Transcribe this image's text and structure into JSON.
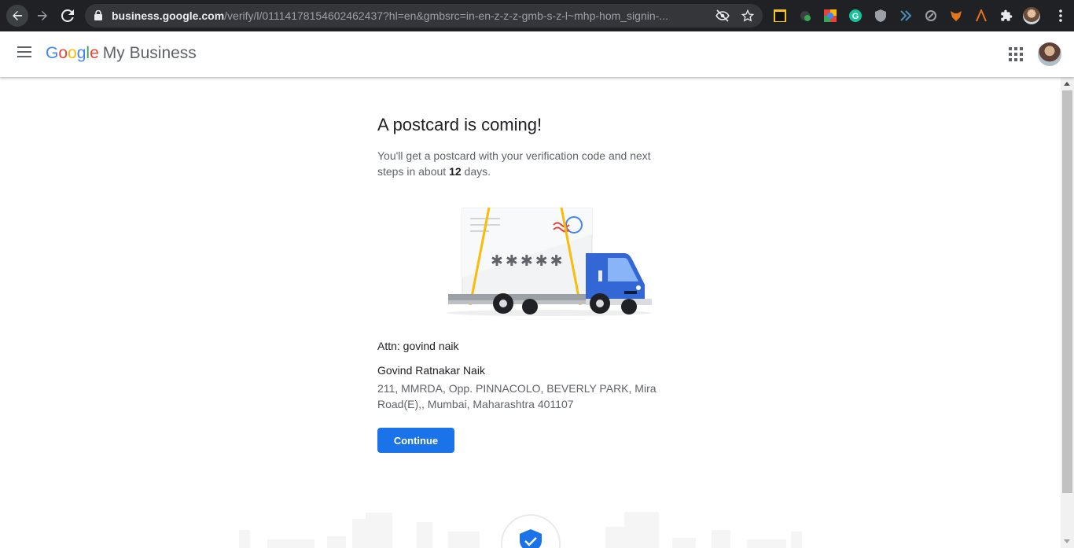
{
  "browser": {
    "url_host": "business.google.com",
    "url_path": "/verify/l/01114178154602462437?hl=en&gmbsrc=in-en-z-z-z-gmb-s-z-l~mhp-hom_signin-...",
    "icons": [
      "back-icon",
      "forward-icon",
      "reload-icon",
      "lock-icon",
      "eye-off-icon",
      "star-icon",
      "extensions-icon"
    ]
  },
  "header": {
    "logo_letters": [
      "G",
      "o",
      "o",
      "g",
      "l",
      "e"
    ],
    "product": "My Business"
  },
  "main": {
    "title": "A postcard is coming!",
    "desc_before": "You'll get a postcard with your verification code and next steps in about ",
    "desc_days": "12",
    "desc_after": " days.",
    "postcard_code": "✱✱✱✱✱",
    "attn": "Attn: govind naik",
    "recipient": "Govind Ratnakar Naik",
    "address": "211, MMRDA, Opp. PINNACOLO, BEVERLY PARK, Mira Road(E),, Mumbai, Maharashtra 401107",
    "continue_label": "Continue"
  },
  "colors": {
    "primary": "#1a73e8",
    "chrome_bg": "#202124",
    "truck_blue": "#3367d6"
  }
}
